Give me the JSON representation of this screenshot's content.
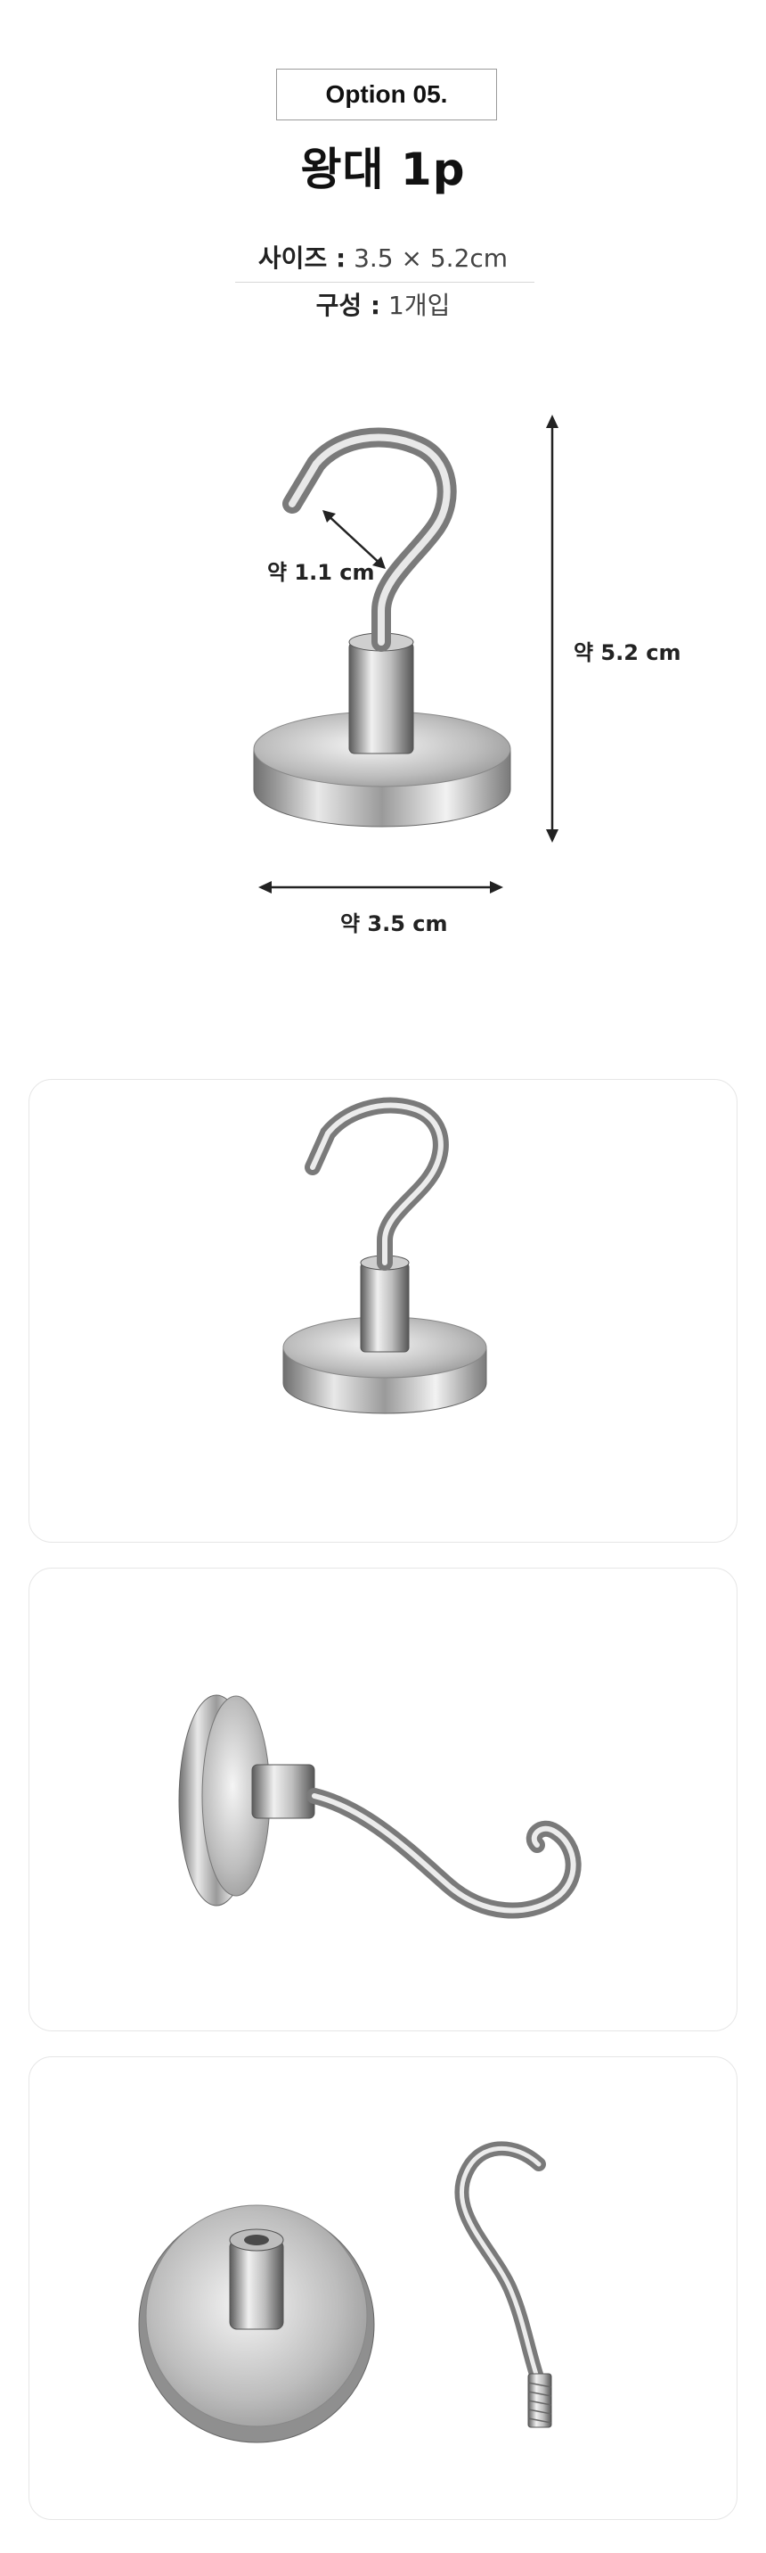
{
  "option_label": "Option 05.",
  "title": "왕대 1p",
  "specs": {
    "size_label": "사이즈 :",
    "size_value": "3.5 × 5.2cm",
    "composition_label": "구성 :",
    "composition_value": "1개입"
  },
  "dimensions": {
    "hook_opening": "약 1.1 cm",
    "height": "약 5.2 cm",
    "width": "약 3.5 cm"
  }
}
